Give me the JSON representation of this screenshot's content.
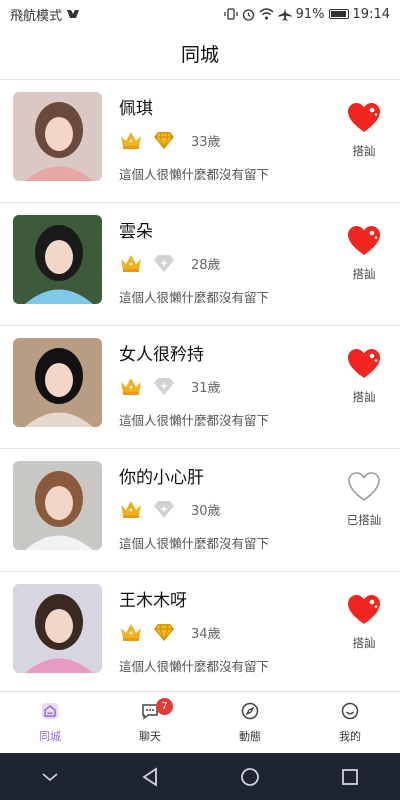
{
  "status_bar": {
    "left_text": "飛航模式",
    "battery": "91%",
    "time": "19:14",
    "battery_level": 0.91
  },
  "header": {
    "title": "同城"
  },
  "users": [
    {
      "name": "佩琪",
      "age": "33歲",
      "desc": "這個人很懶什麼都沒有留下",
      "greet_label": "搭訕",
      "greeted": false,
      "diamond_active": true,
      "avatar_colors": [
        "#d9c8c4",
        "#6b4a3e",
        "#e8a6a8"
      ]
    },
    {
      "name": "雲朵",
      "age": "28歲",
      "desc": "這個人很懶什麼都沒有留下",
      "greet_label": "搭訕",
      "greeted": false,
      "diamond_active": false,
      "avatar_colors": [
        "#3d5a3a",
        "#1a1a1a",
        "#7ec8e8"
      ]
    },
    {
      "name": "女人很矜持",
      "age": "31歲",
      "desc": "這個人很懶什麼都沒有留下",
      "greet_label": "搭訕",
      "greeted": false,
      "diamond_active": false,
      "avatar_colors": [
        "#b89c84",
        "#121212",
        "#e6d8cf"
      ]
    },
    {
      "name": "你的小心肝",
      "age": "30歲",
      "desc": "這個人很懶什麼都沒有留下",
      "greet_label": "已搭訕",
      "greeted": true,
      "diamond_active": false,
      "avatar_colors": [
        "#c9c7c3",
        "#8a5a3c",
        "#f2f2f2"
      ]
    },
    {
      "name": "王木木呀",
      "age": "34歲",
      "desc": "這個人很懶什麼都沒有留下",
      "greet_label": "搭訕",
      "greeted": false,
      "diamond_active": true,
      "avatar_colors": [
        "#d7d5e0",
        "#3a2a22",
        "#e79bc4"
      ]
    }
  ],
  "tabs": [
    {
      "label": "同城",
      "icon": "home-icon",
      "active": true
    },
    {
      "label": "聊天",
      "icon": "chat-icon",
      "active": false,
      "badge": "7"
    },
    {
      "label": "動態",
      "icon": "compass-icon",
      "active": false
    },
    {
      "label": "我的",
      "icon": "smile-icon",
      "active": false
    }
  ],
  "colors": {
    "heart_active": "#f2261f",
    "heart_inactive": "#9a9a9a",
    "crown": "#f2b01e",
    "diamond_gold": "#f0b81a",
    "diamond_gray": "#d2d2d2",
    "tab_active": "#9b6bd3",
    "badge": "#e53935",
    "nav_bar": "#1f2433"
  }
}
